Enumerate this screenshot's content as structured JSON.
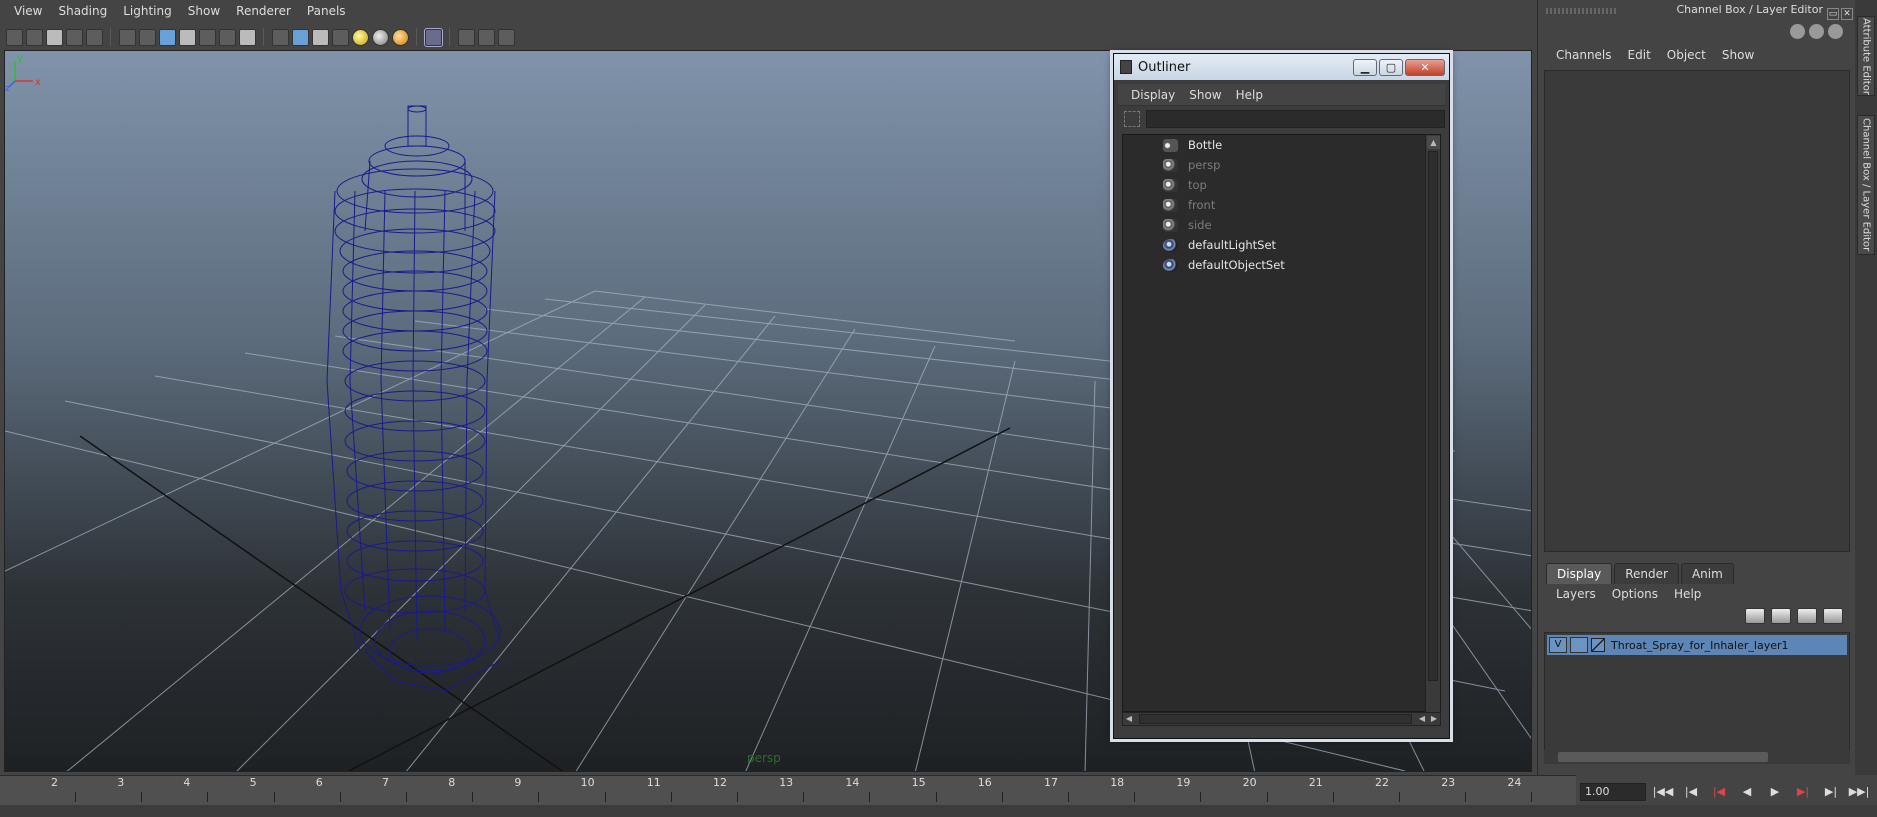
{
  "menubar": {
    "items": [
      "View",
      "Shading",
      "Lighting",
      "Show",
      "Renderer",
      "Panels"
    ]
  },
  "viewport": {
    "camera_label": "persp",
    "axis_labels": {
      "y": "y",
      "x": "x",
      "z": "z"
    }
  },
  "outliner": {
    "title": "Outliner",
    "menu": [
      "Display",
      "Show",
      "Help"
    ],
    "filter_placeholder": "",
    "items": [
      {
        "label": "Bottle",
        "dim": false,
        "icon": "group-icon"
      },
      {
        "label": "persp",
        "dim": true,
        "icon": "camera-icon"
      },
      {
        "label": "top",
        "dim": true,
        "icon": "camera-icon"
      },
      {
        "label": "front",
        "dim": true,
        "icon": "camera-icon"
      },
      {
        "label": "side",
        "dim": true,
        "icon": "camera-icon"
      },
      {
        "label": "defaultLightSet",
        "dim": false,
        "icon": "set-icon"
      },
      {
        "label": "defaultObjectSet",
        "dim": false,
        "icon": "set-icon"
      }
    ]
  },
  "channel_box": {
    "title": "Channel Box / Layer Editor",
    "menu": [
      "Channels",
      "Edit",
      "Object",
      "Show"
    ],
    "tabs": [
      "Display",
      "Render",
      "Anim"
    ],
    "active_tab": "Display",
    "layer_menu": [
      "Layers",
      "Options",
      "Help"
    ],
    "layer": {
      "visible_flag": "V",
      "name": "Throat_Spray_for_Inhaler_layer1"
    }
  },
  "side_tabs": [
    "Attribute Editor",
    "Channel Box / Layer Editor"
  ],
  "timeline": {
    "frames": [
      "2",
      "3",
      "4",
      "5",
      "6",
      "7",
      "8",
      "9",
      "10",
      "11",
      "12",
      "13",
      "14",
      "15",
      "16",
      "17",
      "18",
      "19",
      "20",
      "21",
      "22",
      "23",
      "24"
    ],
    "current_frame": "1.00"
  },
  "colors": {
    "wireframe": "#1a1a8c",
    "layer_highlight": "#5d86b7",
    "grid": "#9aa6b3"
  }
}
